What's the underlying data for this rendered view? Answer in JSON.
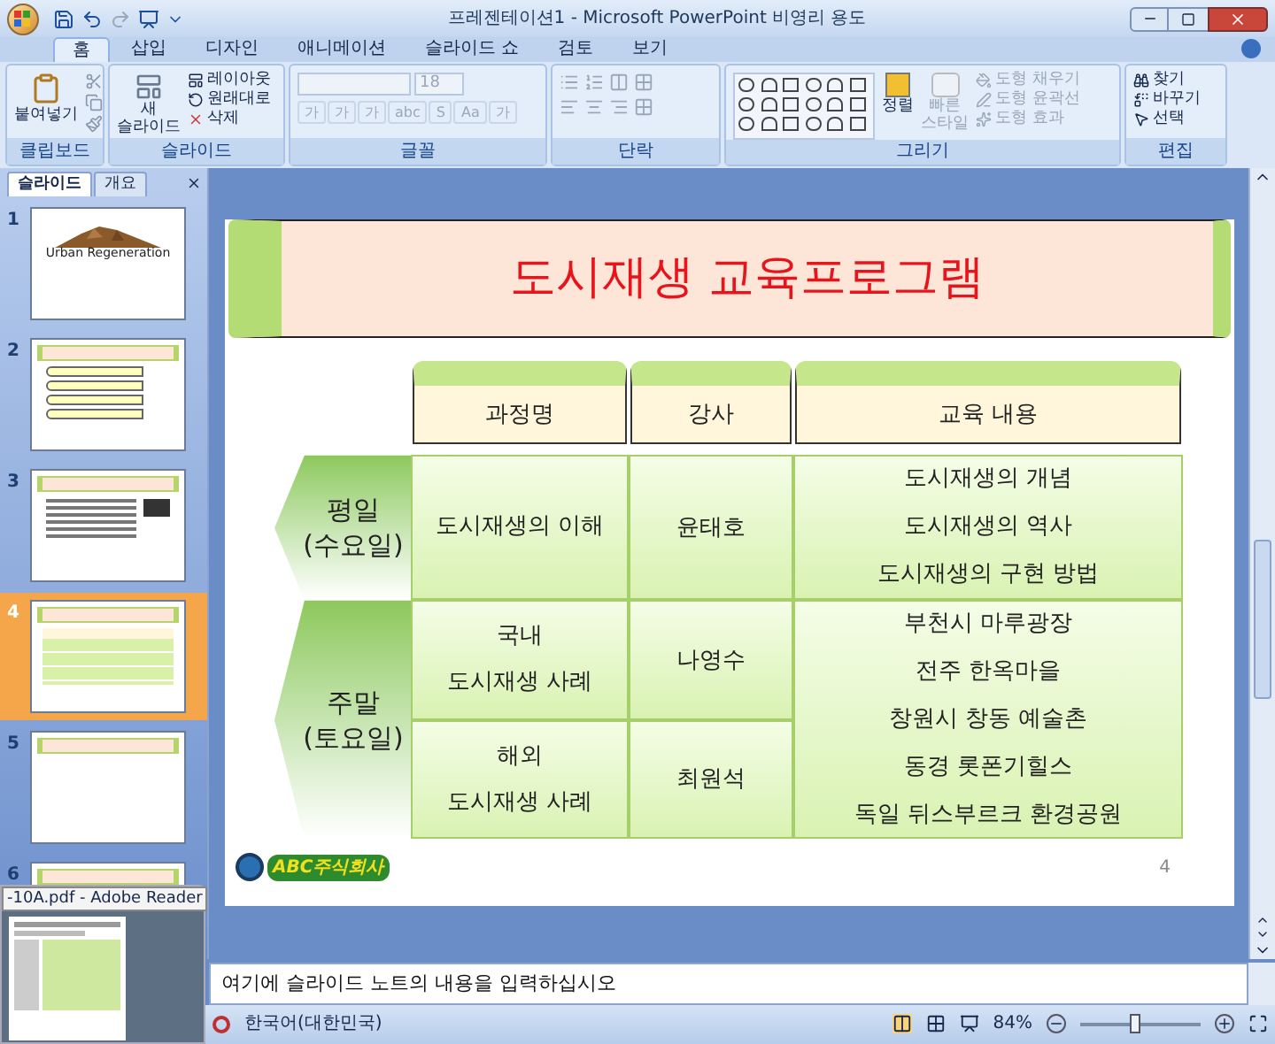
{
  "window": {
    "title": "프레젠테이션1 - Microsoft PowerPoint 비영리 용도"
  },
  "ribbon_tabs": [
    {
      "label": "홈",
      "selected": true
    },
    {
      "label": "삽입",
      "selected": false
    },
    {
      "label": "디자인",
      "selected": false
    },
    {
      "label": "애니메이션",
      "selected": false
    },
    {
      "label": "슬라이드 쇼",
      "selected": false
    },
    {
      "label": "검토",
      "selected": false
    },
    {
      "label": "보기",
      "selected": false
    }
  ],
  "ribbon": {
    "clipboard": {
      "title": "클립보드",
      "paste": "붙여넣기"
    },
    "slides": {
      "title": "슬라이드",
      "new_slide": [
        "새",
        "슬라이드"
      ],
      "commands": [
        "레이아웃",
        "원래대로",
        "삭제"
      ]
    },
    "font": {
      "title": "글꼴",
      "size": "18",
      "disabled": true,
      "buttons": [
        "가",
        "가",
        "가",
        "abc",
        "S",
        "Aa",
        "가"
      ]
    },
    "paragraph": {
      "title": "단락",
      "disabled": true
    },
    "drawing": {
      "title": "그리기",
      "arrange": "정렬",
      "quick_styles": [
        "빠른",
        "스타일"
      ],
      "commands": [
        {
          "label": "도형 채우기",
          "disabled": true
        },
        {
          "label": "도형 윤곽선",
          "disabled": true
        },
        {
          "label": "도형 효과",
          "disabled": true
        }
      ]
    },
    "editing": {
      "title": "편집",
      "commands": [
        "찾기",
        "바꾸기",
        "선택"
      ]
    }
  },
  "slide_pane": {
    "tabs": [
      {
        "label": "슬라이드",
        "selected": true
      },
      {
        "label": "개요",
        "selected": false
      }
    ],
    "slides": [
      {
        "number": "1",
        "selected": false,
        "kind": "title",
        "title": "Urban Regeneration"
      },
      {
        "number": "2",
        "selected": false,
        "kind": "list"
      },
      {
        "number": "3",
        "selected": false,
        "kind": "text"
      },
      {
        "number": "4",
        "selected": true,
        "kind": "table"
      },
      {
        "number": "5",
        "selected": false,
        "kind": "blank"
      },
      {
        "number": "6",
        "selected": false,
        "kind": "blank"
      }
    ]
  },
  "taskbar_preview": {
    "title": "-10A.pdf - Adobe Reader"
  },
  "slide": {
    "title": "도시재생 교육프로그램",
    "columns": [
      "과정명",
      "강사",
      "교육 내용"
    ],
    "groups": [
      {
        "label": [
          "평일",
          "(수요일)"
        ],
        "rows": [
          {
            "course": [
              "도시재생의 이해"
            ],
            "instructor": "윤태호"
          }
        ],
        "contents": [
          "도시재생의 개념",
          "도시재생의 역사",
          "도시재생의 구현 방법"
        ]
      },
      {
        "label": [
          "주말",
          "(토요일)"
        ],
        "rows": [
          {
            "course": [
              "국내",
              "도시재생 사례"
            ],
            "instructor": "나영수"
          },
          {
            "course": [
              "해외",
              "도시재생 사례"
            ],
            "instructor": "최원석"
          }
        ],
        "contents": [
          "부천시 마루광장",
          "전주 한옥마을",
          "창원시 창동 예술촌",
          "동경 롯폰기힐스",
          "독일 뒤스부르크 환경공원"
        ]
      }
    ],
    "logo": "ABC주식회사",
    "page_number": "4"
  },
  "notes": {
    "text": "여기에 슬라이드 노트의 내용을 입력하십시오"
  },
  "status_bar": {
    "language": "한국어(대한민국)",
    "zoom": "84%",
    "zoom_slider": {
      "level": 0.45
    }
  }
}
